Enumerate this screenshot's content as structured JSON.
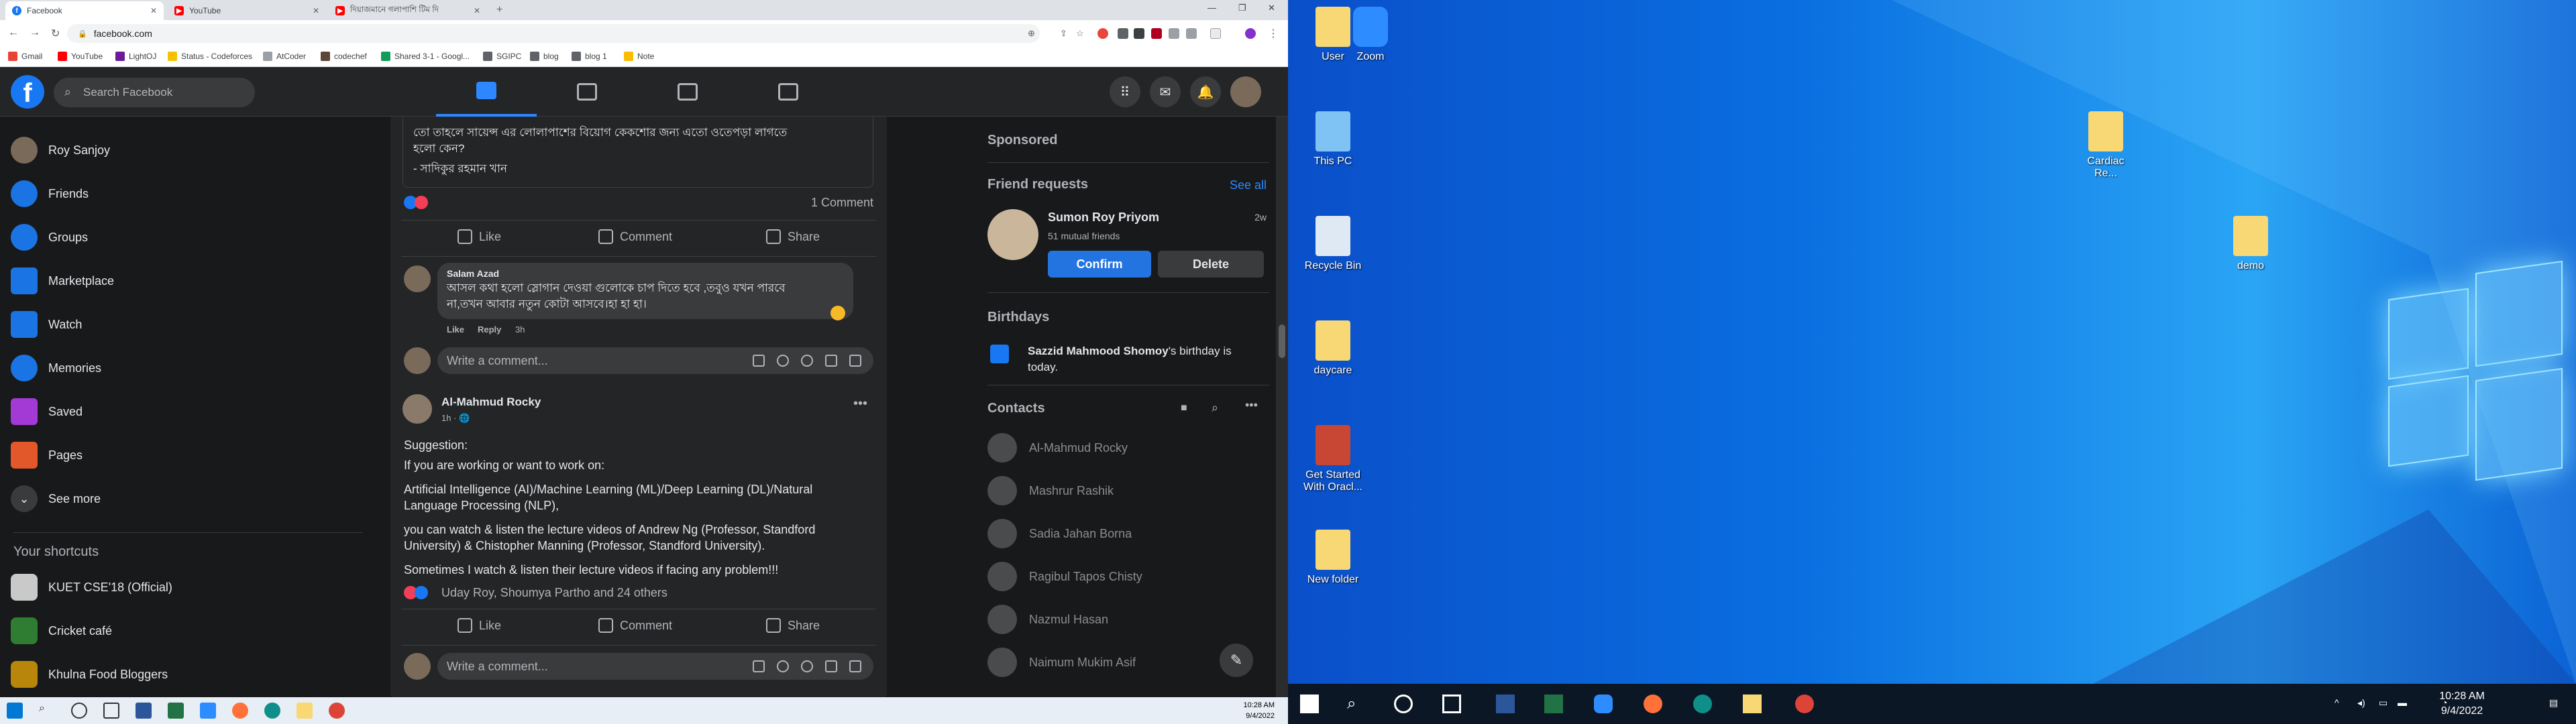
{
  "browser": {
    "tabs": [
      {
        "title": "Facebook",
        "icon": "facebook-icon",
        "active": true
      },
      {
        "title": "YouTube",
        "icon": "youtube-icon",
        "active": false
      },
      {
        "title": "দিয়াজমানে গলাপাশি টিম দি",
        "icon": "youtube-icon",
        "active": false
      }
    ],
    "url": "facebook.com",
    "bookmarks": [
      "Gmail",
      "YouTube",
      "LightOJ",
      "Status - Codeforces",
      "AtCoder",
      "codechef",
      "Shared 3-1 - Googl...",
      "SGIPC",
      "blog",
      "blog 1",
      "Note"
    ]
  },
  "fb": {
    "search_placeholder": "Search Facebook",
    "sidebar": [
      {
        "label": "Roy Sanjoy",
        "icon": "profile-avatar"
      },
      {
        "label": "Friends",
        "icon": "friends-icon"
      },
      {
        "label": "Groups",
        "icon": "groups-icon"
      },
      {
        "label": "Marketplace",
        "icon": "marketplace-icon"
      },
      {
        "label": "Watch",
        "icon": "watch-icon"
      },
      {
        "label": "Memories",
        "icon": "memories-icon"
      },
      {
        "label": "Saved",
        "icon": "saved-icon"
      },
      {
        "label": "Pages",
        "icon": "pages-icon"
      },
      {
        "label": "See more",
        "icon": "chevron-down-icon"
      }
    ],
    "shortcuts_title": "Your shortcuts",
    "shortcuts": [
      "KUET CSE'18 (Official)",
      "Cricket café",
      "Khulna Food Bloggers"
    ],
    "post1": {
      "text_top": "তো তাহলে সায়েন্স এর লোলাপাশের বিয়োগ কেকশোর জন্য এতো ওতেপড়া লাগতে",
      "text_line2": "হলো কেন?",
      "author_sign": "- সাদিকুর রহমান খান",
      "comments_count": "1 Comment",
      "like": "Like",
      "comment": "Comment",
      "share": "Share",
      "comment_author": "Salam Azad",
      "comment_text_1": "আসল কথা হলো স্লোগান দেওয়া গুলোকে চাপ দিতে হবে ,তবুও যখন পারবে",
      "comment_text_2": "না,তখন আবার নতুন কোটা আসবে।হা হা হা।",
      "comment_like": "Like",
      "comment_reply": "Reply",
      "comment_time": "3h",
      "write_comment": "Write a comment..."
    },
    "post2": {
      "author": "Al-Mahmud Rocky",
      "time": "1h · ",
      "lines": [
        "Suggestion:",
        "If you are working or want to work on:",
        "Artificial Intelligence (AI)/Machine Learning (ML)/Deep Learning (DL)/Natural",
        "Language Processing (NLP),",
        "you can watch & listen the lecture videos of Andrew Ng (Professor, Standford",
        "University) & Chistopher Manning (Professor, Standford University).",
        "Sometimes I watch & listen their lecture videos if facing any problem!!!"
      ],
      "reactors": "Uday Roy, Shoumya Partho and 24 others",
      "like": "Like",
      "comment": "Comment",
      "share": "Share",
      "write_comment": "Write a comment..."
    },
    "right": {
      "sponsored": "Sponsored",
      "friend_requests": "Friend requests",
      "see_all": "See all",
      "req_name": "Sumon Roy Priyom",
      "req_time": "2w",
      "req_mutual": "51 mutual friends",
      "confirm": "Confirm",
      "delete": "Delete",
      "birthdays": "Birthdays",
      "bday_name": "Sazzid Mahmood Shomoy",
      "bday_rest": "'s birthday is",
      "bday_rest2": "today.",
      "contacts": "Contacts",
      "contact_list": [
        "Al-Mahmud Rocky",
        "Mashrur Rashik",
        "Sadia Jahan Borna",
        "Ragibul Tapos Chisty",
        "Nazmul Hasan",
        "Naimum Mukim Asif"
      ]
    }
  },
  "taskbar_left": {
    "time": "10:28 AM",
    "date": "9/4/2022"
  },
  "desktop": {
    "icons": [
      "User",
      "Zoom",
      "This PC",
      "Cardiac Re...",
      "Recycle Bin",
      "demo",
      "daycare",
      "Get Started With Oracl...",
      "New folder"
    ],
    "time": "10:28 AM",
    "date": "9/4/2022"
  }
}
